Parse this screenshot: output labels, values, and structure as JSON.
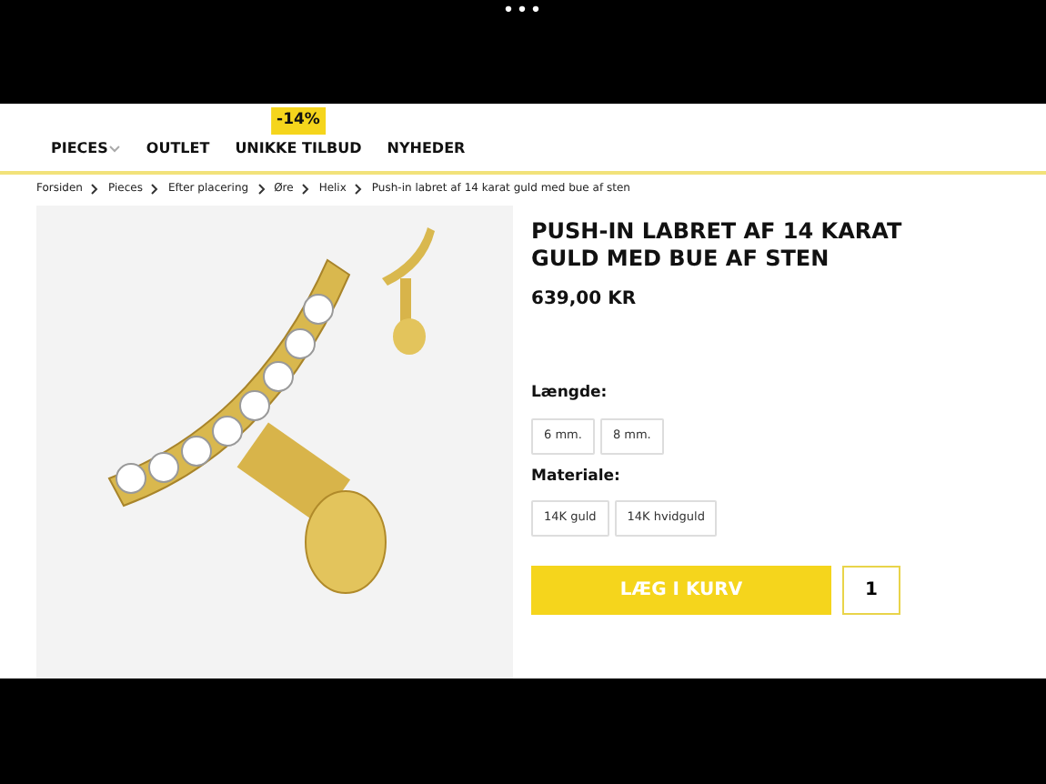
{
  "status_bar": {
    "dots": "•••"
  },
  "nav": [
    {
      "label": "PIECES",
      "dropdown": true
    },
    {
      "label": "OUTLET",
      "dropdown": false
    },
    {
      "label": "UNIKKE TILBUD",
      "dropdown": false,
      "badge": "-14%"
    },
    {
      "label": "NYHEDER",
      "dropdown": false
    }
  ],
  "breadcrumb": [
    "Forsiden",
    "Pieces",
    "Efter placering",
    "Øre",
    "Helix",
    "Push-in labret af 14 karat guld med bue af sten"
  ],
  "product": {
    "title": "PUSH-IN LABRET AF 14 KARAT GULD MED BUE AF STEN",
    "price": "639,00 KR",
    "options": [
      {
        "label": "Længde:",
        "values": [
          "6 mm.",
          "8 mm."
        ]
      },
      {
        "label": "Materiale:",
        "values": [
          "14K guld",
          "14K hvidguld"
        ]
      }
    ],
    "add_button": "LÆG I KURV",
    "quantity": "1"
  }
}
